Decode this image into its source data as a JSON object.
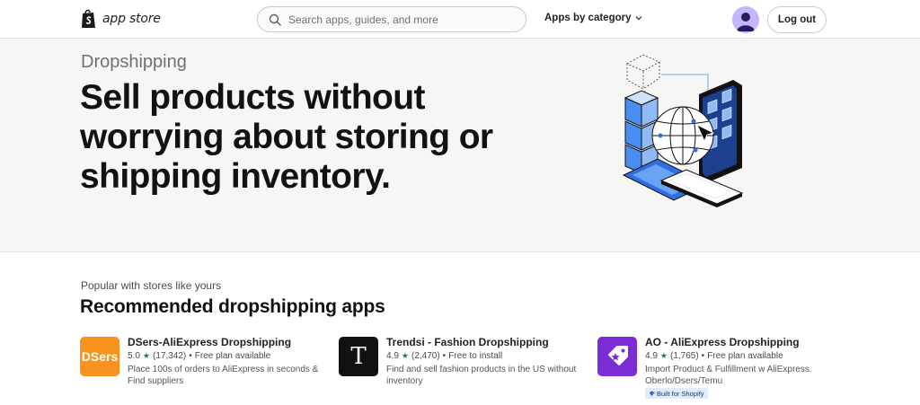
{
  "header": {
    "logo_text": "app store",
    "search_placeholder": "Search apps, guides, and more",
    "category_label": "Apps by category",
    "logout_label": "Log out"
  },
  "hero": {
    "kicker": "Dropshipping",
    "title": "Sell products without worrying about storing or shipping inventory."
  },
  "section": {
    "subtitle": "Popular with stores like yours",
    "title": "Recommended dropshipping apps"
  },
  "apps": [
    {
      "name": "DSers-AliExpress Dropshipping",
      "icon_label": "DSers",
      "rating": "5.0",
      "reviews": "(17,342)",
      "pricing": "Free plan available",
      "description": "Place 100s of orders to AliExpress in seconds & Find suppliers",
      "icon_color": "#f7931e"
    },
    {
      "name": "Trendsi - Fashion Dropshipping",
      "icon_label": "T",
      "rating": "4.9",
      "reviews": "(2,470)",
      "pricing": "Free to install",
      "description": "Find and sell fashion products in the US without inventory",
      "icon_color": "#111111"
    },
    {
      "name": "AO - AliExpress Dropshipping",
      "icon_label": "",
      "rating": "4.9",
      "reviews": "(1,765)",
      "pricing": "Free plan available",
      "description": "Import Product & Fulfillment w AliExpress. Oberlo/Dsers/Temu",
      "badge": "Built for Shopify",
      "icon_color": "#7b2cd6"
    }
  ],
  "separator": "•",
  "star": "★"
}
